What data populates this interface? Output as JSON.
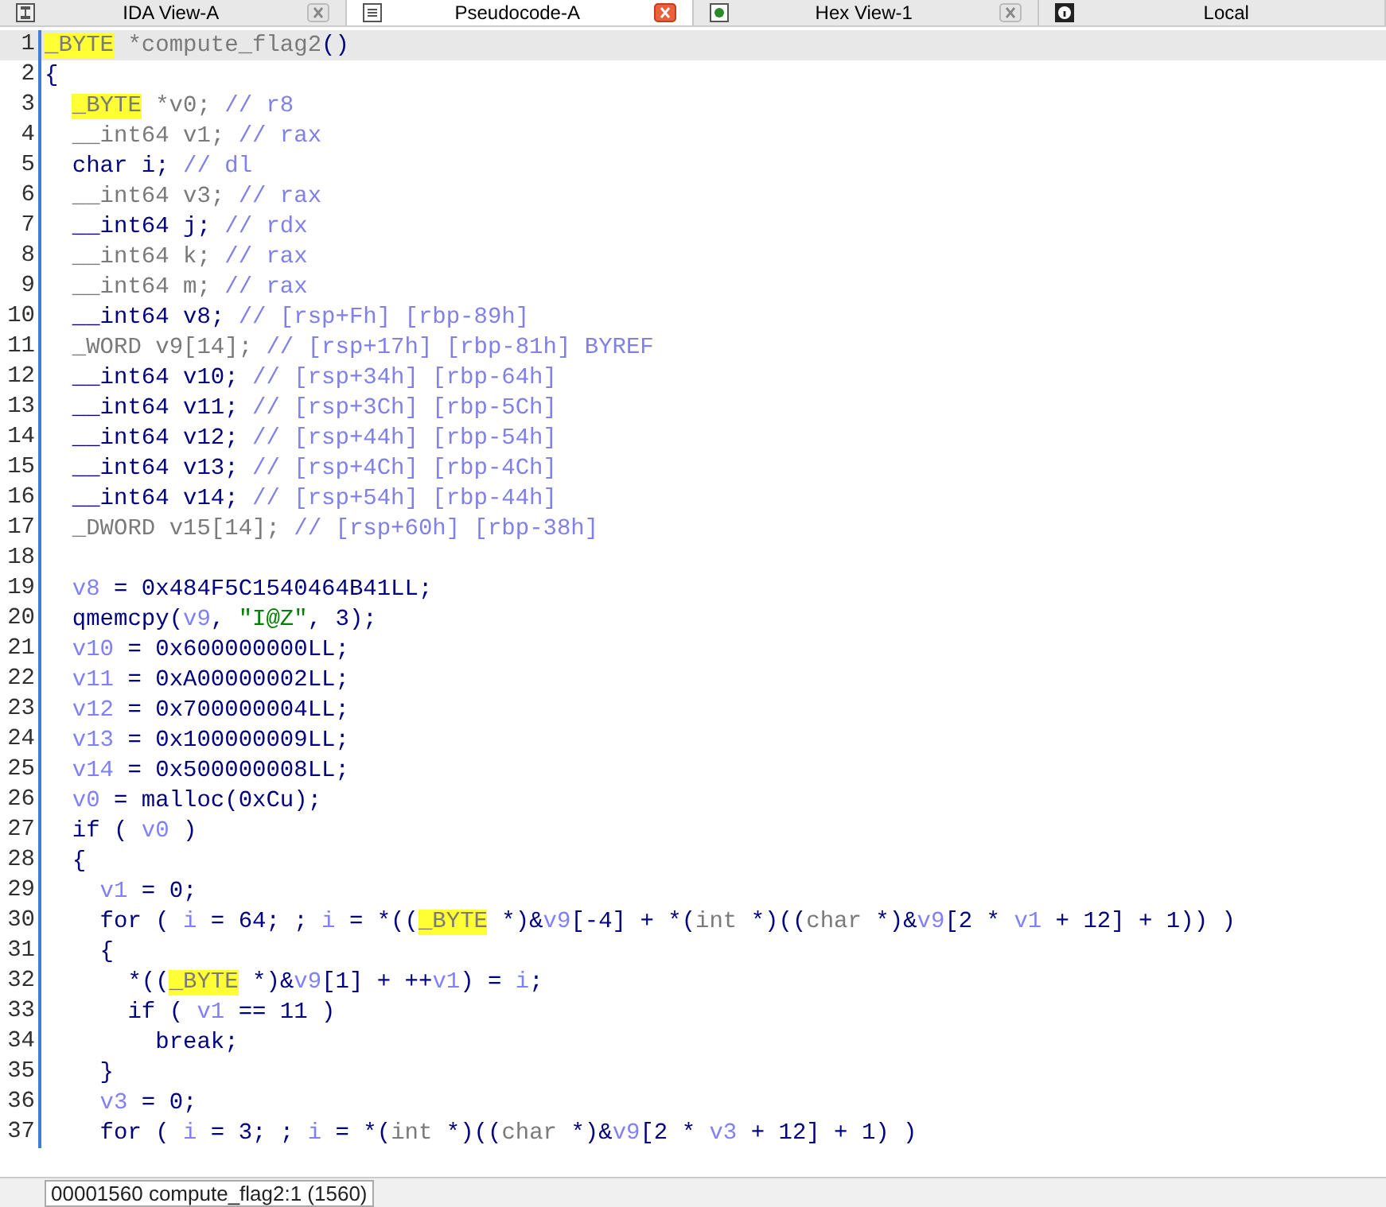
{
  "tabs": [
    {
      "label": "IDA View-A",
      "selected": false
    },
    {
      "label": "Pseudocode-A",
      "selected": true
    },
    {
      "label": "Hex View-1",
      "selected": false
    },
    {
      "label": "Local",
      "selected": false
    }
  ],
  "code_lines": [
    {
      "number": "1",
      "current": true,
      "tokens": [
        {
          "t": "_BYTE",
          "kind": "hl"
        },
        {
          "t": " *compute_flag2",
          "kind": "grey"
        },
        {
          "t": "()",
          "kind": "plain"
        }
      ]
    },
    {
      "number": "2",
      "current": false,
      "tokens": [
        {
          "t": "{",
          "kind": "plain"
        }
      ]
    },
    {
      "number": "3",
      "current": false,
      "tokens": [
        {
          "t": "_BYTE",
          "kind": "hl_indent"
        },
        {
          "t": " *v0; ",
          "kind": "grey"
        },
        {
          "t": "// r8",
          "kind": "cmt"
        }
      ]
    },
    {
      "number": "4",
      "current": false,
      "tokens": [
        {
          "t": "  __int64 v1; ",
          "kind": "grey"
        },
        {
          "t": "// rax",
          "kind": "cmt"
        }
      ]
    },
    {
      "number": "5",
      "current": false,
      "tokens": [
        {
          "t": "  char i; ",
          "kind": "plain"
        },
        {
          "t": "// dl",
          "kind": "cmt"
        }
      ]
    },
    {
      "number": "6",
      "current": false,
      "tokens": [
        {
          "t": "  __int64 v3; ",
          "kind": "grey"
        },
        {
          "t": "// rax",
          "kind": "cmt"
        }
      ]
    },
    {
      "number": "7",
      "current": false,
      "tokens": [
        {
          "t": "  __int64 j; ",
          "kind": "plain"
        },
        {
          "t": "// rdx",
          "kind": "cmt"
        }
      ]
    },
    {
      "number": "8",
      "current": false,
      "tokens": [
        {
          "t": "  __int64 k; ",
          "kind": "grey"
        },
        {
          "t": "// rax",
          "kind": "cmt"
        }
      ]
    },
    {
      "number": "9",
      "current": false,
      "tokens": [
        {
          "t": "  __int64 m; ",
          "kind": "grey"
        },
        {
          "t": "// rax",
          "kind": "cmt"
        }
      ]
    },
    {
      "number": "10",
      "current": false,
      "tokens": [
        {
          "t": "  __int64 v8; ",
          "kind": "plain"
        },
        {
          "t": "// [rsp+Fh] [rbp-89h]",
          "kind": "cmt"
        }
      ]
    },
    {
      "number": "11",
      "current": false,
      "tokens": [
        {
          "t": "  _WORD v9[14]; ",
          "kind": "grey"
        },
        {
          "t": "// [rsp+17h] [rbp-81h] BYREF",
          "kind": "cmt"
        }
      ]
    },
    {
      "number": "12",
      "current": false,
      "tokens": [
        {
          "t": "  __int64 v10; ",
          "kind": "plain"
        },
        {
          "t": "// [rsp+34h] [rbp-64h]",
          "kind": "cmt"
        }
      ]
    },
    {
      "number": "13",
      "current": false,
      "tokens": [
        {
          "t": "  __int64 v11; ",
          "kind": "plain"
        },
        {
          "t": "// [rsp+3Ch] [rbp-5Ch]",
          "kind": "cmt"
        }
      ]
    },
    {
      "number": "14",
      "current": false,
      "tokens": [
        {
          "t": "  __int64 v12; ",
          "kind": "plain"
        },
        {
          "t": "// [rsp+44h] [rbp-54h]",
          "kind": "cmt"
        }
      ]
    },
    {
      "number": "15",
      "current": false,
      "tokens": [
        {
          "t": "  __int64 v13; ",
          "kind": "plain"
        },
        {
          "t": "// [rsp+4Ch] [rbp-4Ch]",
          "kind": "cmt"
        }
      ]
    },
    {
      "number": "16",
      "current": false,
      "tokens": [
        {
          "t": "  __int64 v14; ",
          "kind": "plain"
        },
        {
          "t": "// [rsp+54h] [rbp-44h]",
          "kind": "cmt"
        }
      ]
    },
    {
      "number": "17",
      "current": false,
      "tokens": [
        {
          "t": "  _DWORD v15[14]; ",
          "kind": "grey"
        },
        {
          "t": "// [rsp+60h] [rbp-38h]",
          "kind": "cmt"
        }
      ]
    },
    {
      "number": "18",
      "current": false
    },
    {
      "number": "19",
      "current": false,
      "tokens": [
        {
          "t": "  v8",
          "kind": "var"
        },
        {
          "t": " = 0x484F5C1540464B41LL;",
          "kind": "plain"
        }
      ]
    },
    {
      "number": "20",
      "current": false,
      "tokens": [
        {
          "t": "  qmemcpy(",
          "kind": "plain"
        },
        {
          "t": "v9",
          "kind": "var"
        },
        {
          "t": ", ",
          "kind": "plain"
        },
        {
          "t": "\"I@Z\"",
          "kind": "str"
        },
        {
          "t": ", 3);",
          "kind": "plain"
        }
      ]
    },
    {
      "number": "21",
      "current": false,
      "tokens": [
        {
          "t": "  v10",
          "kind": "var"
        },
        {
          "t": " = 0x600000000LL;",
          "kind": "plain"
        }
      ]
    },
    {
      "number": "22",
      "current": false,
      "tokens": [
        {
          "t": "  v11",
          "kind": "var"
        },
        {
          "t": " = 0xA00000002LL;",
          "kind": "plain"
        }
      ]
    },
    {
      "number": "23",
      "current": false,
      "tokens": [
        {
          "t": "  v12",
          "kind": "var"
        },
        {
          "t": " = 0x700000004LL;",
          "kind": "plain"
        }
      ]
    },
    {
      "number": "24",
      "current": false,
      "tokens": [
        {
          "t": "  v13",
          "kind": "var"
        },
        {
          "t": " = 0x100000009LL;",
          "kind": "plain"
        }
      ]
    },
    {
      "number": "25",
      "current": false,
      "tokens": [
        {
          "t": "  v14",
          "kind": "var"
        },
        {
          "t": " = 0x500000008LL;",
          "kind": "plain"
        }
      ]
    },
    {
      "number": "26",
      "current": false,
      "tokens": [
        {
          "t": "  v0",
          "kind": "var"
        },
        {
          "t": " = malloc(0xCu);",
          "kind": "plain"
        }
      ]
    },
    {
      "number": "27",
      "current": false,
      "tokens": [
        {
          "t": "  if ( ",
          "kind": "plain"
        },
        {
          "t": "v0",
          "kind": "var"
        },
        {
          "t": " )",
          "kind": "plain"
        }
      ]
    },
    {
      "number": "28",
      "current": false,
      "tokens": [
        {
          "t": "  {",
          "kind": "plain"
        }
      ]
    },
    {
      "number": "29",
      "current": false,
      "tokens": [
        {
          "t": "    v1",
          "kind": "var"
        },
        {
          "t": " = 0;",
          "kind": "plain"
        }
      ]
    },
    {
      "number": "30",
      "current": false,
      "tokens": [
        {
          "t": "    for ( ",
          "kind": "plain"
        },
        {
          "t": "i",
          "kind": "var"
        },
        {
          "t": " = 64; ; ",
          "kind": "plain"
        },
        {
          "t": "i",
          "kind": "var"
        },
        {
          "t": " = *((",
          "kind": "plain"
        },
        {
          "t": "_BYTE",
          "kind": "hl"
        },
        {
          "t": " *)&",
          "kind": "plain"
        },
        {
          "t": "v9",
          "kind": "var"
        },
        {
          "t": "[-4] + *(",
          "kind": "plain"
        },
        {
          "t": "int",
          "kind": "grey"
        },
        {
          "t": " *)((",
          "kind": "plain"
        },
        {
          "t": "char",
          "kind": "grey"
        },
        {
          "t": " *)&",
          "kind": "plain"
        },
        {
          "t": "v9",
          "kind": "var"
        },
        {
          "t": "[2 * ",
          "kind": "plain"
        },
        {
          "t": "v1",
          "kind": "var"
        },
        {
          "t": " + 12] + 1)) )",
          "kind": "plain"
        }
      ]
    },
    {
      "number": "31",
      "current": false,
      "tokens": [
        {
          "t": "    {",
          "kind": "plain"
        }
      ]
    },
    {
      "number": "32",
      "current": false,
      "tokens": [
        {
          "t": "      *((",
          "kind": "plain"
        },
        {
          "t": "_BYTE",
          "kind": "hl"
        },
        {
          "t": " *)&",
          "kind": "plain"
        },
        {
          "t": "v9",
          "kind": "var"
        },
        {
          "t": "[1] + ++",
          "kind": "plain"
        },
        {
          "t": "v1",
          "kind": "var"
        },
        {
          "t": ") = ",
          "kind": "plain"
        },
        {
          "t": "i",
          "kind": "var"
        },
        {
          "t": ";",
          "kind": "plain"
        }
      ]
    },
    {
      "number": "33",
      "current": false,
      "tokens": [
        {
          "t": "      if ( ",
          "kind": "plain"
        },
        {
          "t": "v1",
          "kind": "var"
        },
        {
          "t": " == 11 )",
          "kind": "plain"
        }
      ]
    },
    {
      "number": "34",
      "current": false,
      "tokens": [
        {
          "t": "        break;",
          "kind": "plain"
        }
      ]
    },
    {
      "number": "35",
      "current": false,
      "tokens": [
        {
          "t": "    }",
          "kind": "plain"
        }
      ]
    },
    {
      "number": "36",
      "current": false,
      "tokens": [
        {
          "t": "    v3",
          "kind": "var"
        },
        {
          "t": " = 0;",
          "kind": "plain"
        }
      ]
    },
    {
      "number": "37",
      "current": false,
      "tokens": [
        {
          "t": "    for ( ",
          "kind": "plain"
        },
        {
          "t": "i",
          "kind": "var"
        },
        {
          "t": " = 3; ; ",
          "kind": "plain"
        },
        {
          "t": "i",
          "kind": "var"
        },
        {
          "t": " = *(",
          "kind": "plain"
        },
        {
          "t": "int",
          "kind": "grey"
        },
        {
          "t": " *)((",
          "kind": "plain"
        },
        {
          "t": "char",
          "kind": "grey"
        },
        {
          "t": " *)&",
          "kind": "plain"
        },
        {
          "t": "v9",
          "kind": "var"
        },
        {
          "t": "[2 * ",
          "kind": "plain"
        },
        {
          "t": "v3",
          "kind": "var"
        },
        {
          "t": " + 12] + 1) )",
          "kind": "plain"
        }
      ]
    }
  ],
  "status_bar": {
    "text": "00001560 compute_flag2:1 (1560)"
  }
}
